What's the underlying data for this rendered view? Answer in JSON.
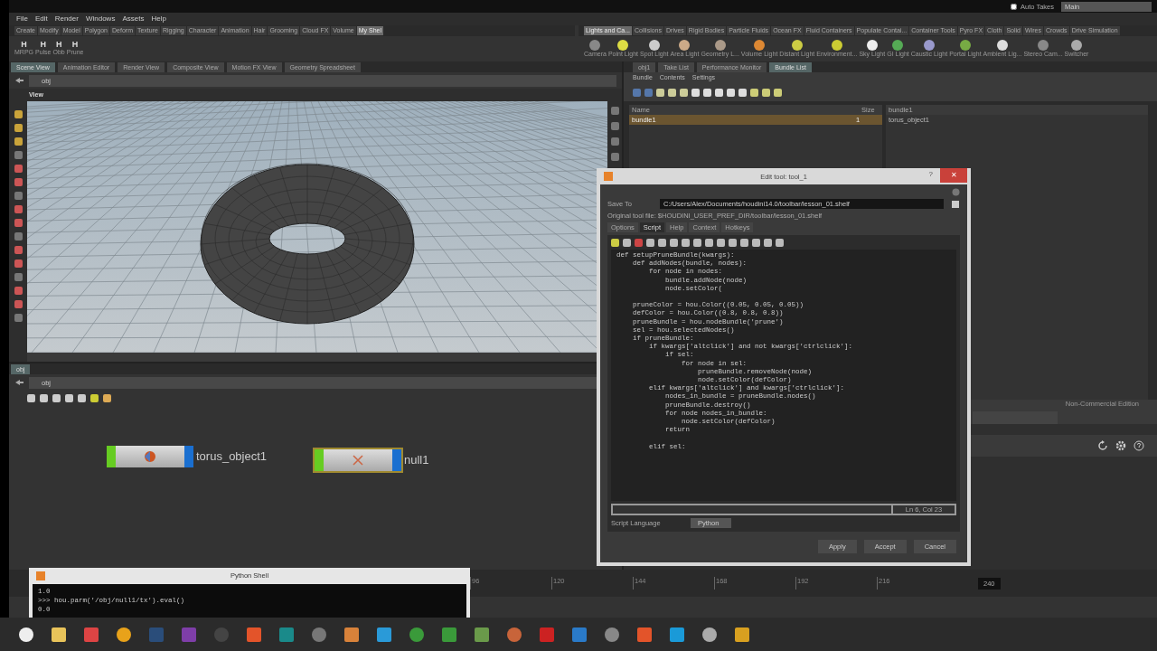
{
  "menu": [
    "File",
    "Edit",
    "Render",
    "Windows",
    "Assets",
    "Help"
  ],
  "auto_takes": {
    "label": "Auto Takes",
    "checked": false
  },
  "take": "Main",
  "left_shelf": {
    "tabs": [
      {
        "label": "Create",
        "selected": false
      },
      {
        "label": "Modify",
        "selected": false
      },
      {
        "label": "Model",
        "selected": false
      },
      {
        "label": "Polygon",
        "selected": false
      },
      {
        "label": "Deform",
        "selected": false
      },
      {
        "label": "Texture",
        "selected": false
      },
      {
        "label": "Rigging",
        "selected": false
      },
      {
        "label": "Character",
        "selected": false
      },
      {
        "label": "Animation",
        "selected": false
      },
      {
        "label": "Hair",
        "selected": false
      },
      {
        "label": "Grooming",
        "selected": false
      },
      {
        "label": "Cloud FX",
        "selected": false
      },
      {
        "label": "Volume",
        "selected": false
      },
      {
        "label": "My Shel",
        "selected": true
      }
    ],
    "tools": [
      {
        "glyph": "H",
        "label": "MRPG"
      },
      {
        "glyph": "H",
        "label": "Pulse"
      },
      {
        "glyph": "H",
        "label": "Obb"
      },
      {
        "glyph": "H",
        "label": "Prune"
      }
    ]
  },
  "right_shelf": {
    "tabs": [
      {
        "label": "Lights and Ca...",
        "selected": true
      },
      {
        "label": "Collisions",
        "selected": false
      },
      {
        "label": "Drives",
        "selected": false
      },
      {
        "label": "Rigid Bodies",
        "selected": false
      },
      {
        "label": "Particle Fluids",
        "selected": false
      },
      {
        "label": "Ocean FX",
        "selected": false
      },
      {
        "label": "Fluid Containers",
        "selected": false
      },
      {
        "label": "Populate Contai...",
        "selected": false
      },
      {
        "label": "Container Tools",
        "selected": false
      },
      {
        "label": "Pyro FX",
        "selected": false
      },
      {
        "label": "Cloth",
        "selected": false
      },
      {
        "label": "Solid",
        "selected": false
      },
      {
        "label": "Wires",
        "selected": false
      },
      {
        "label": "Crowds",
        "selected": false
      },
      {
        "label": "Drive Simulation",
        "selected": false
      }
    ],
    "tools": [
      "Camera",
      "Point Light",
      "Spot Light",
      "Area Light",
      "Geometry L...",
      "Volume Light",
      "Distant Light",
      "Environment...",
      "Sky Light",
      "GI Light",
      "Caustic Light",
      "Portal Light",
      "Ambient Lig...",
      "Stereo Cam...",
      "Switcher"
    ]
  },
  "scene_tabs": [
    {
      "label": "Scene View",
      "selected": true
    },
    {
      "label": "Animation Editor",
      "selected": false
    },
    {
      "label": "Render View",
      "selected": false
    },
    {
      "label": "Composite View",
      "selected": false
    },
    {
      "label": "Motion FX View",
      "selected": false
    },
    {
      "label": "Geometry Spreadsheet",
      "selected": false
    }
  ],
  "scene_path": "obj",
  "viewport_label": "View",
  "right_tabs": [
    {
      "label": "obj1",
      "selected": false
    },
    {
      "label": "Take List",
      "selected": false
    },
    {
      "label": "Performance Monitor",
      "selected": false
    },
    {
      "label": "Bundle List",
      "selected": true
    }
  ],
  "bundle_menu": [
    "Bundle",
    "Contents",
    "Settings"
  ],
  "bundle_table": {
    "columns": [
      "Name",
      "Size"
    ],
    "rows": [
      {
        "name": "bundle1",
        "size": "1",
        "selected": true
      }
    ]
  },
  "bundle_contents": {
    "title": "bundle1",
    "items": [
      "torus_object1"
    ]
  },
  "edition": "Non-Commercial Edition",
  "network": {
    "tab": "obj",
    "path": "obj",
    "nodes": [
      {
        "label": "torus_object1",
        "selected": false
      },
      {
        "label": "null1",
        "selected": true
      }
    ]
  },
  "timeline": {
    "ticks": [
      "96",
      "120",
      "144",
      "168",
      "192",
      "216"
    ],
    "end_frame": "240"
  },
  "dialog": {
    "title": "Edit tool: tool_1",
    "help_glyph": "?",
    "close_glyph": "✕",
    "save_label": "Save To",
    "save_path": "C:/Users/Alex/Documents/houdini14.0/toolbar/lesson_01.shelf",
    "original": "Original tool file: $HOUDINI_USER_PREF_DIR/toolbar/lesson_01.shelf",
    "tabs": [
      {
        "label": "Options",
        "selected": false
      },
      {
        "label": "Script",
        "selected": true
      },
      {
        "label": "Help",
        "selected": false
      },
      {
        "label": "Context",
        "selected": false
      },
      {
        "label": "Hotkeys",
        "selected": false
      }
    ],
    "code_blocks": [
      [
        "def setupPruneBundle(kwargs):",
        "    def addNodes(bundle, nodes):",
        "        for node in nodes:",
        "            bundle.addNode(node)",
        "            node.setColor("
      ],
      [
        "    pruneColor = hou.Color((0.05, 0.05, 0.05))",
        "    defColor = hou.Color((0.8, 0.8, 0.8))",
        "    pruneBundle = hou.nodeBundle('prune')",
        "    sel = hou.selectedNodes()",
        "    if pruneBundle:",
        "        if kwargs['altclick'] and not kwargs['ctrlclick']:",
        "            if sel:",
        "                for node in sel:",
        "                    pruneBundle.removeNode(node)",
        "                    node.setColor(defColor)",
        "        elif kwargs['altclick'] and kwargs['ctrlclick']:",
        "            nodes_in_bundle = pruneBundle.nodes()",
        "            pruneBundle.destroy()",
        "            for node nodes_in_bundle:",
        "                node.setColor(defColor)",
        "            return"
      ],
      [
        "        elif sel:"
      ]
    ],
    "cursor": "Ln 6, Col 23",
    "language_label": "Script Language",
    "language": "Python",
    "buttons": [
      "Apply",
      "Accept",
      "Cancel"
    ]
  },
  "python_shell": {
    "title": "Python Shell",
    "lines": [
      "1.0",
      ">>> hou.parm('/obj/null1/tx').eval()",
      "0.0"
    ]
  }
}
